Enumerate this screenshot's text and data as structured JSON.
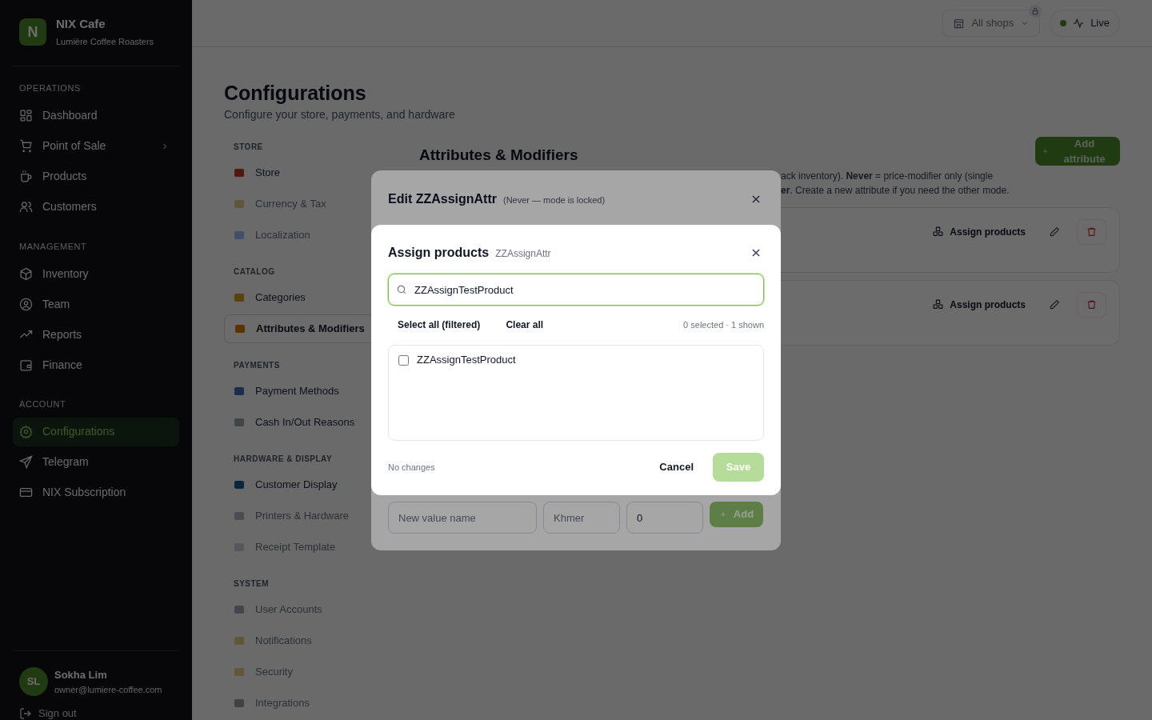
{
  "sidebar": {
    "brand": {
      "initial": "N",
      "name": "NIX Cafe",
      "subtitle": "Lumière Coffee Roasters"
    },
    "sections": [
      {
        "title": "OPERATIONS",
        "items": [
          {
            "label": "Dashboard",
            "selected": false
          },
          {
            "label": "Point of Sale",
            "selected": false,
            "has_submenu": true
          },
          {
            "label": "Products",
            "selected": false
          },
          {
            "label": "Customers",
            "selected": false
          }
        ]
      },
      {
        "title": "MANAGEMENT",
        "items": [
          {
            "label": "Inventory",
            "selected": false
          },
          {
            "label": "Team",
            "selected": false
          },
          {
            "label": "Reports",
            "selected": false
          },
          {
            "label": "Finance",
            "selected": false
          }
        ]
      },
      {
        "title": "ACCOUNT",
        "items": [
          {
            "label": "Configurations",
            "selected": true
          },
          {
            "label": "Telegram",
            "selected": false
          },
          {
            "label": "NIX Subscription",
            "selected": false
          }
        ]
      }
    ],
    "user": {
      "initials": "SL",
      "name": "Sokha Lim",
      "email": "owner@lumiere-coffee.com"
    },
    "sign_out": "Sign out"
  },
  "topbar": {
    "shop_selector": "All shops",
    "live": "Live"
  },
  "page": {
    "title": "Configurations",
    "subtitle": "Configure your store, payments, and hardware"
  },
  "settings_nav": [
    {
      "title": "STORE",
      "items": [
        {
          "label": "Store",
          "selected": false,
          "disabled": false
        },
        {
          "label": "Currency & Tax",
          "selected": false,
          "disabled": true
        },
        {
          "label": "Localization",
          "selected": false,
          "disabled": true
        }
      ]
    },
    {
      "title": "CATALOG",
      "items": [
        {
          "label": "Categories",
          "selected": false,
          "disabled": false
        },
        {
          "label": "Attributes & Modifiers",
          "selected": true,
          "disabled": false
        }
      ]
    },
    {
      "title": "PAYMENTS",
      "items": [
        {
          "label": "Payment Methods",
          "selected": false,
          "disabled": false
        },
        {
          "label": "Cash In/Out Reasons",
          "selected": false,
          "disabled": false
        }
      ]
    },
    {
      "title": "HARDWARE & DISPLAY",
      "items": [
        {
          "label": "Customer Display",
          "selected": false,
          "disabled": false
        },
        {
          "label": "Printers & Hardware",
          "selected": false,
          "disabled": true
        },
        {
          "label": "Receipt Template",
          "selected": false,
          "disabled": true
        }
      ]
    },
    {
      "title": "SYSTEM",
      "items": [
        {
          "label": "User Accounts",
          "selected": false,
          "disabled": true
        },
        {
          "label": "Notifications",
          "selected": false,
          "disabled": true
        },
        {
          "label": "Security",
          "selected": false,
          "disabled": true
        },
        {
          "label": "Integrations",
          "selected": false,
          "disabled": true
        }
      ]
    }
  ],
  "content": {
    "title": "Attributes & Modifiers",
    "description": [
      "ack inventory). **Never** = price-modifier only (single",
      "**er**. Create a new attribute if you need the other mode."
    ],
    "add_button": "Add attribute",
    "attributes": [
      {
        "assign": "Assign products"
      },
      {
        "assign": "Assign products"
      }
    ]
  },
  "edit_dialog": {
    "title": "Edit ZZAssignAttr",
    "note": "(Never — mode is locked)",
    "new_value": {
      "name_placeholder": "New value name",
      "khmer_placeholder": "Khmer",
      "price_value": "0",
      "add": "Add"
    }
  },
  "assign_dialog": {
    "title": "Assign products",
    "subtitle": "ZZAssignAttr",
    "search_value": "ZZAssignTestProduct",
    "select_all": "Select all (filtered)",
    "clear_all": "Clear all",
    "counter": "0 selected · 1 shown",
    "products": [
      {
        "label": "ZZAssignTestProduct",
        "checked": false
      }
    ],
    "status": "No changes",
    "cancel": "Cancel",
    "save": "Save",
    "save_disabled": true
  }
}
